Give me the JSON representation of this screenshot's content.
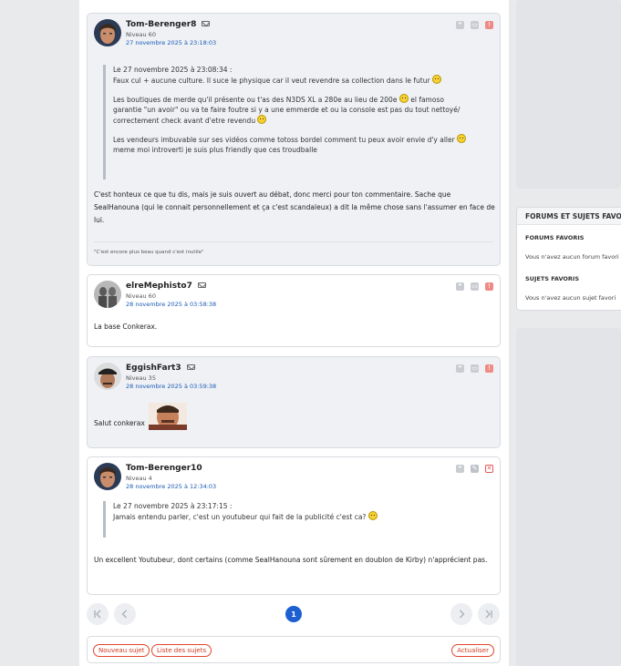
{
  "posts": [
    {
      "author": "Tom-Berenger8",
      "level": "Niveau 60",
      "date": "27 novembre 2025 à 23:18:03",
      "quote_header": "Le 27 novembre 2025 à 23:08:34 :",
      "quote_lines": [
        "Faux cul + aucune culture. Il suce le physique car il veut revendre sa collection dans le futur",
        "Les boutiques de merde qu'il présente ou t'as des N3DS XL a 280e au lieu de 200e",
        "el famoso",
        "garantie \"un avoir\" ou va te faire foutre si y a une emmerde et ou la console est pas du tout nettoyé/",
        "correctement check avant d'etre revendu",
        "Les vendeurs imbuvable sur ses vidéos comme totoss bordel comment tu peux avoir envie d'y aller",
        "meme moi introverti je suis plus friendly que ces troudballe"
      ],
      "body": "C'est honteux ce que tu dis, mais je suis ouvert au débat, donc merci pour ton commentaire. Sache que SealHanouna (qui le connait personnellement et ça c'est scandaleux) a dit la même chose sans l'assumer en face de lui.",
      "signature": "\"C'est encore plus beau quand c'est inutile\""
    },
    {
      "author": "elreMephisto7",
      "level": "Niveau 60",
      "date": "28 novembre 2025 à 03:58:38",
      "body": "La base Conkerax."
    },
    {
      "author": "EggishFart3",
      "level": "Niveau 35",
      "date": "28 novembre 2025 à 03:59:38",
      "body": "Salut conkerax"
    },
    {
      "author": "Tom-Berenger10",
      "level": "Niveau 4",
      "date": "28 novembre 2025 à 12:34:03",
      "quote_header": "Le 27 novembre 2025 à 23:17:15 :",
      "quote_lines": [
        "Jamais entendu parler, c'est un youtubeur qui fait de la publicité c'est ca?"
      ],
      "body": "Un excellent Youtubeur, dont certains (comme SealHanouna sont sûrement en doublon de Kirby) n'apprécient pas."
    }
  ],
  "pagination": {
    "current": "1",
    "first_icon": "first-page-icon",
    "prev_icon": "prev-page-icon",
    "next_icon": "next-page-icon",
    "last_icon": "last-page-icon"
  },
  "actions": {
    "new_topic": "Nouveau sujet",
    "topic_list": "Liste des sujets",
    "refresh": "Actualiser"
  },
  "sidebar": {
    "title": "FORUMS ET SUJETS FAVORIS",
    "forums_heading": "FORUMS FAVORIS",
    "forums_empty": "Vous n'avez aucun forum favori",
    "topics_heading": "SUJETS FAVORIS",
    "topics_empty": "Vous n'avez aucun sujet favori"
  },
  "colors": {
    "link_blue": "#1a5bb5",
    "accent_orange": "#e3452b",
    "page_blue": "#1d5fd1"
  }
}
